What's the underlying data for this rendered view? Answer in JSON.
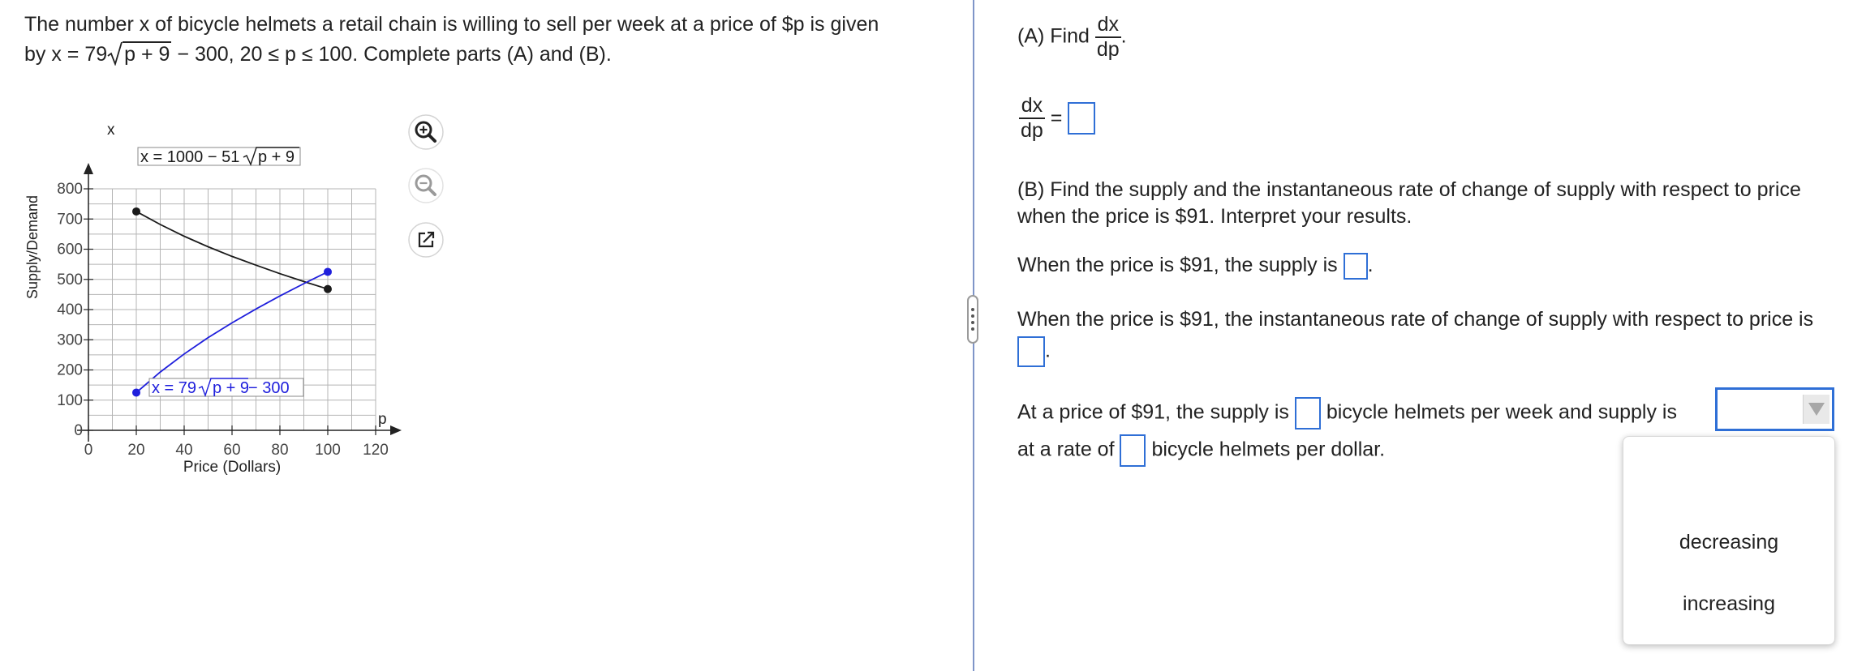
{
  "problem": {
    "sentence_1": "The number x of bicycle helmets a retail chain is willing to sell per week at a price of $p is given",
    "line2_prefix": "by x = 79",
    "radicand": "p + 9",
    "line2_suffix": " − 300, 20 ≤ p ≤ 100. Complete parts (A) and (B)."
  },
  "graph": {
    "y_axis_title": "Supply/Demand",
    "x_axis_title": "Price (Dollars)",
    "y_axis_letter": "x",
    "x_axis_letter": "p",
    "demand_label_prefix": "x = 1000 − 51",
    "demand_label_radicand": "p + 9",
    "supply_label_prefix": "x = 79",
    "supply_label_radicand": "p + 9",
    "supply_label_suffix": " − 300",
    "zoom_in_icon": "zoom-in-icon",
    "zoom_out_icon": "zoom-out-icon",
    "popout_icon": "external-link-icon",
    "colors": {
      "demand": "#1a1a1a",
      "supply": "#1f1fdc",
      "grid": "#b4b4b4",
      "label_border": "#888888"
    }
  },
  "chart_data": {
    "type": "line",
    "title": "",
    "xlabel": "Price (Dollars)",
    "ylabel": "Supply/Demand",
    "xlim": [
      0,
      120
    ],
    "ylim": [
      0,
      800
    ],
    "x_ticks": [
      0,
      20,
      40,
      60,
      80,
      100,
      120
    ],
    "y_ticks": [
      0,
      100,
      200,
      300,
      400,
      500,
      600,
      700,
      800
    ],
    "grid": true,
    "series": [
      {
        "name": "x = 1000 − 51√(p + 9)",
        "x": [
          20,
          30,
          40,
          50,
          60,
          70,
          80,
          90,
          100
        ],
        "y": [
          725,
          682,
          643,
          608,
          576,
          547,
          519,
          493,
          468
        ]
      },
      {
        "name": "x = 79√(p + 9) − 300",
        "x": [
          20,
          30,
          40,
          50,
          60,
          70,
          80,
          90,
          100
        ],
        "y": [
          125,
          193,
          253,
          307,
          356,
          402,
          445,
          486,
          525
        ]
      }
    ]
  },
  "part_a": {
    "prompt": "(A) Find",
    "num": "dx",
    "den": "dp",
    "period": ".",
    "answer_num": "dx",
    "answer_den": "dp",
    "equals": "="
  },
  "part_b": {
    "prompt_line1": "(B) Find the supply and the instantaneous rate of change of supply with respect to price",
    "prompt_line2": "when the price is $91. Interpret your results.",
    "supply_sentence": "When the price is $91, the supply is",
    "rate_sentence": "When the price is $91, the instantaneous rate of change of supply with respect to price is",
    "period": ".",
    "interp_part1": "At a price of $91, the supply is",
    "interp_part2": "bicycle helmets per week and supply is",
    "interp_part3": "at a rate of",
    "interp_part4": "bicycle helmets per dollar.",
    "dropdown_options": [
      "decreasing",
      "increasing"
    ]
  }
}
